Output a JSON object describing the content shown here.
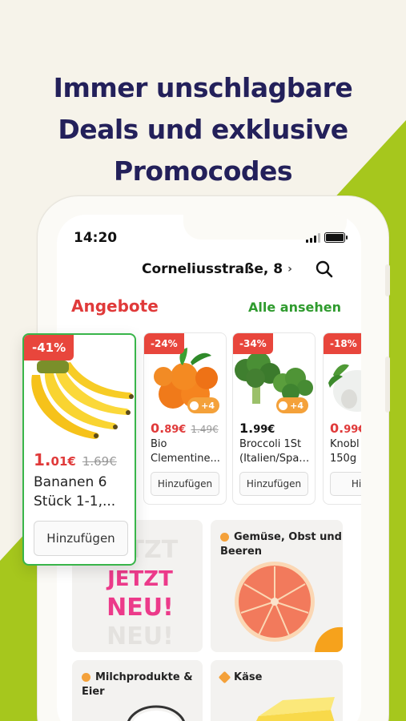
{
  "headline": [
    "Immer unschlagbare",
    "Deals und exklusive",
    "Promocodes"
  ],
  "colors": {
    "accent_green": "#a6c71d",
    "headline": "#23205a",
    "sale_red": "#e8463c",
    "link_green": "#2f9b2e"
  },
  "status_bar": {
    "time": "14:20",
    "icons": [
      "signal-icon",
      "battery-icon"
    ]
  },
  "header": {
    "address": "Corneliusstraße, 8",
    "address_chevron": "›",
    "search_icon": "search-icon"
  },
  "offers": {
    "title": "Angebote",
    "see_all": "Alle ansehen",
    "featured": {
      "discount": "-41%",
      "price_main": "1.",
      "price_cents": "01€",
      "old_price": "1.69€",
      "name_line1": "Bananen 6",
      "name_line2": "Stück 1-1,...",
      "add_label": "Hinzufügen"
    },
    "items": [
      {
        "discount": "-24%",
        "extra": "+4",
        "price_main": "0.",
        "price_cents": "89€",
        "old_price": "1.49€",
        "name_line1": "Bio",
        "name_line2": "Clementine...",
        "add_label": "Hinzufügen"
      },
      {
        "discount": "-34%",
        "extra": "+4",
        "price_main": "1.",
        "price_cents": "99€",
        "old_price": "",
        "name_line1": "Broccoli 1St",
        "name_line2": "(Italien/Span...",
        "add_label": "Hinzufügen"
      },
      {
        "discount": "-18%",
        "extra": "",
        "price_main": "0.",
        "price_cents": "99€",
        "old_price": "",
        "name_line1": "Knobl",
        "name_line2": "150g",
        "add_label": "Hinz"
      }
    ]
  },
  "categories": [
    {
      "label": "",
      "art_lines": [
        "JETZT",
        "JETZT",
        "NEU!",
        "NEU!"
      ]
    },
    {
      "label": "Gemüse, Obst und Beeren"
    },
    {
      "label": "Milchprodukte & Eier"
    },
    {
      "label": "Käse"
    }
  ]
}
